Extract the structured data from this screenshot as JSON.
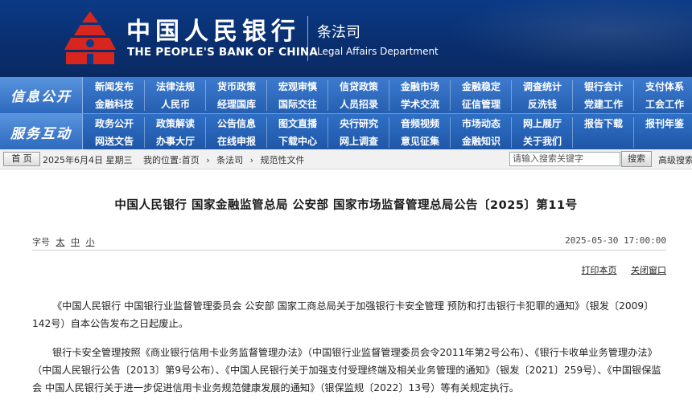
{
  "header": {
    "bank_name_cn": "中国人民银行",
    "bank_name_en": "THE PEOPLE'S BANK OF CHINA",
    "dept_cn": "条法司",
    "dept_en": "Legal Affairs Department",
    "logo_icon": "pboc-emblem-icon",
    "logo_color": "#d7261e"
  },
  "nav": {
    "rows": [
      {
        "head": "信息公开",
        "top": [
          "新闻发布",
          "法律法规",
          "货币政策",
          "宏观审慎",
          "信贷政策",
          "金融市场",
          "金融稳定",
          "调查统计",
          "银行会计",
          "支付体系"
        ],
        "bottom": [
          "金融科技",
          "人民币",
          "经理国库",
          "国际交往",
          "人员招录",
          "学术交流",
          "征信管理",
          "反洗钱",
          "党建工作",
          "工会工作"
        ]
      },
      {
        "head": "服务互动",
        "top": [
          "政务公开",
          "政策解读",
          "公告信息",
          "图文直播",
          "央行研究",
          "音频视频",
          "市场动态",
          "网上展厅",
          "报告下载",
          "报刊年鉴"
        ],
        "bottom": [
          "网送文告",
          "办事大厅",
          "在线申报",
          "下载中心",
          "网上调查",
          "意见征集",
          "金融知识",
          "关于我们"
        ]
      }
    ]
  },
  "breadcrumb": {
    "home_label": "首 页",
    "date": "2025年6月4日 星期三",
    "items": [
      "我的位置:首页",
      "›",
      "条法司",
      "›",
      "规范性文件"
    ],
    "search_placeholder": "请输入搜索关键字",
    "search_label": "搜索",
    "advanced_label": "高级搜索"
  },
  "article": {
    "title": "中国人民银行 国家金融监管总局 公安部 国家市场监督管理总局公告〔2025〕第11号",
    "font_size_label": "字号",
    "font_sizes": [
      "太",
      "中",
      "小"
    ],
    "publish_time": "2025-05-30 17:00:00",
    "print_label": "打印本页",
    "close_label": "关闭窗口",
    "paragraphs": [
      "《中国人民银行 中国银行业监督管理委员会 公安部 国家工商总局关于加强银行卡安全管理 预防和打击银行卡犯罪的通知》（银发〔2009〕142号）自本公告发布之日起废止。",
      "银行卡安全管理按照《商业银行信用卡业务监督管理办法》（中国银行业监督管理委员会令2011年第2号公布）、《银行卡收单业务管理办法》（中国人民银行公告〔2013〕第9号公布）、《中国人民银行关于加强支付受理终端及相关业务管理的通知》（银发〔2021〕259号）、《中国银保监会 中国人民银行关于进一步促进信用卡业务规范健康发展的通知》（银保监规〔2022〕13号）等有关规定执行。"
    ]
  }
}
